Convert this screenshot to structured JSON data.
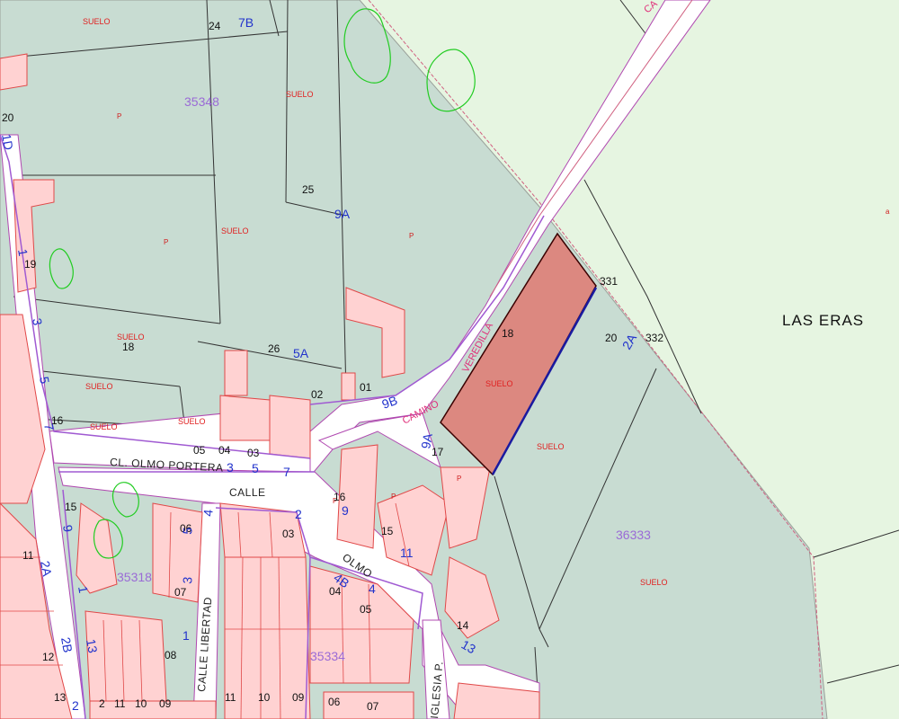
{
  "labels": {
    "area_name": "LAS ERAS",
    "street_olmo_portera": "CL. OLMO PORTERA",
    "street_calle": "CALLE",
    "street_olmo": "OLMO",
    "street_calle_libertad": "CALLE LIBERTAD",
    "street_iglesia": "IGLESIA P.",
    "road_veredilla": "VEREDILLA",
    "road_camino": "CAMINO",
    "land_suelo": "SUELO",
    "land_p": "P",
    "block_35348": "35348",
    "block_36333": "36333",
    "block_35318": "35318",
    "block_35334": "35334",
    "top_road": "CA"
  },
  "highlight": {
    "parcel": "18",
    "color": "#dc8880"
  },
  "colors": {
    "background": "#e6f5e1",
    "parcel_fill": "#c8dcd2",
    "building": "#ffd2d2",
    "building_edge": "#e04848",
    "road": "#ffffff",
    "boundary": "#a05ad2"
  },
  "numbers": {
    "n24": "24",
    "n7B": "7B",
    "n20a": "20",
    "n1D": "1D",
    "n25": "25",
    "n9A": "9A",
    "n19": "19",
    "n1": "1",
    "n3": "3",
    "n18a": "18",
    "n26": "26",
    "n5A": "5A",
    "n5": "5",
    "n7": "7",
    "n16a": "16",
    "n02": "02",
    "n01": "01",
    "n9B": "9B",
    "n05": "05",
    "n04": "04",
    "n03": "03",
    "n331": "331",
    "n20b": "20",
    "n2A": "2A",
    "n332": "332",
    "n18b": "18",
    "n17": "17",
    "n9Aa": "9A",
    "n15a": "15",
    "n9": "9",
    "n06": "06",
    "n11a": "11",
    "n2Aa": "2A",
    "n16b": "16",
    "n15b": "15",
    "n11b": "11",
    "n4B": "4B",
    "n4": "4",
    "n2": "2",
    "n14": "14",
    "n13a": "13",
    "n12": "12",
    "n2B": "2B",
    "n13b": "13",
    "n08": "08",
    "n07": "07",
    "n09": "09",
    "n1b": "1",
    "n10": "10",
    "n11c": "11",
    "n09b": "09"
  }
}
